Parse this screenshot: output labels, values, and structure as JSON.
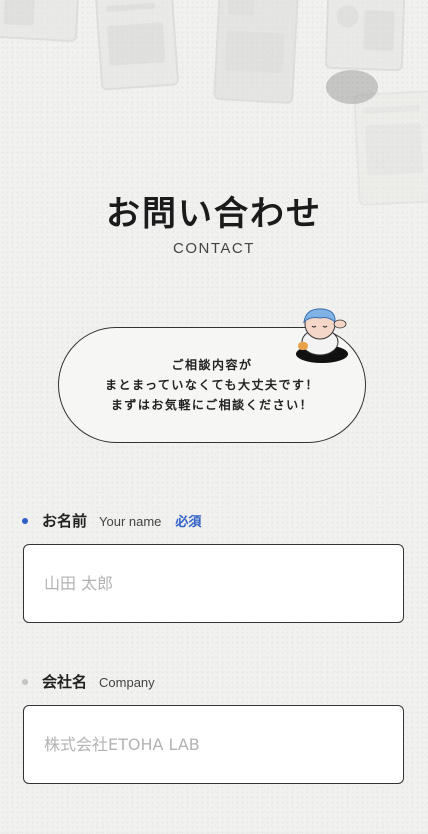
{
  "header": {
    "title": "お問い合わせ",
    "subtitle": "CONTACT"
  },
  "bubble": {
    "lines": [
      "ご相談内容が",
      "まとまっていなくても大丈夫です！",
      "まずはお気軽にご相談ください！"
    ]
  },
  "form": {
    "fields": [
      {
        "label": "お名前",
        "label_en": "Your name",
        "required_label": "必須",
        "placeholder": "山田 太郎",
        "value": "",
        "dot_color": "#2f5fc7"
      },
      {
        "label": "会社名",
        "label_en": "Company",
        "placeholder": "株式会社ETOHA LAB",
        "value": "",
        "dot_color": "#c4c4c4"
      }
    ]
  },
  "colors": {
    "background": "#f1f1ef",
    "accent": "#2f5fc7",
    "border": "#333333"
  }
}
